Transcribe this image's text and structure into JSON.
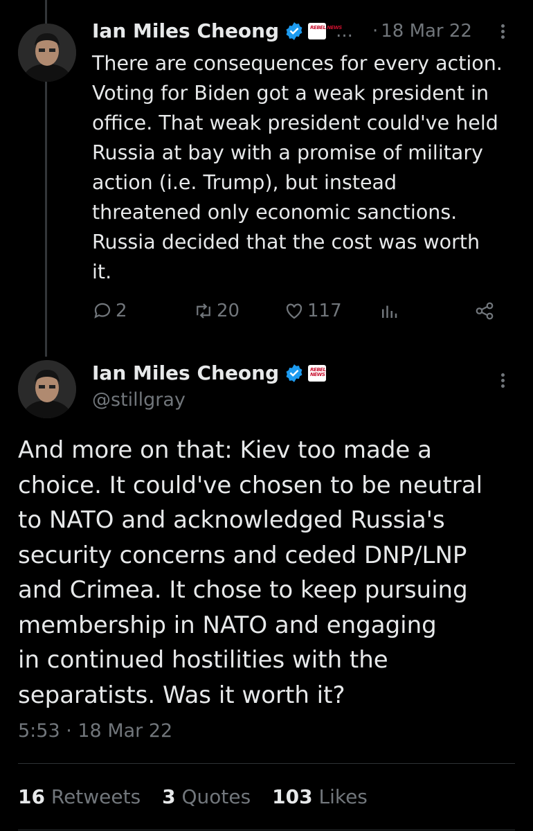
{
  "reply_tweet": {
    "author_name": "Ian Miles Cheong",
    "ellipsis": "...",
    "separator": "·",
    "date": "18 Mar 22",
    "text": "There are consequences for every action.\nVoting for Biden got a weak president in\noffice. That weak president could've held\nRussia at bay with a promise of military\naction (i.e. Trump), but instead\nthreatened only economic sanctions.\nRussia decided that the cost was worth\nit.",
    "actions": {
      "replies": "2",
      "retweets": "20",
      "likes": "117"
    },
    "icons": [
      "reply-icon",
      "retweet-icon",
      "like-icon",
      "analytics-icon",
      "share-icon",
      "more-icon"
    ]
  },
  "main_tweet": {
    "author_name": "Ian Miles Cheong",
    "handle": "@stillgray",
    "text": "And more on that: Kiev too made a\nchoice. It could've chosen to be neutral\nto NATO and acknowledged Russia's\nsecurity concerns and ceded DNP/LNP\nand Crimea. It chose to keep pursuing\nmembership in NATO and engaging\nin continued hostilities with the\nseparatists. Was it worth it?",
    "timestamp": "5:53 · 18 Mar 22",
    "stats": {
      "retweets_count": "16",
      "retweets_label": "Retweets",
      "quotes_count": "3",
      "quotes_label": "Quotes",
      "likes_count": "103",
      "likes_label": "Likes"
    }
  },
  "affiliate_badge_text": "REBEL NEWS",
  "colors": {
    "background": "#000000",
    "text_primary": "#e7e9ea",
    "text_secondary": "#71767b",
    "verified_blue": "#1d9bf0",
    "divider": "#2f3336"
  }
}
